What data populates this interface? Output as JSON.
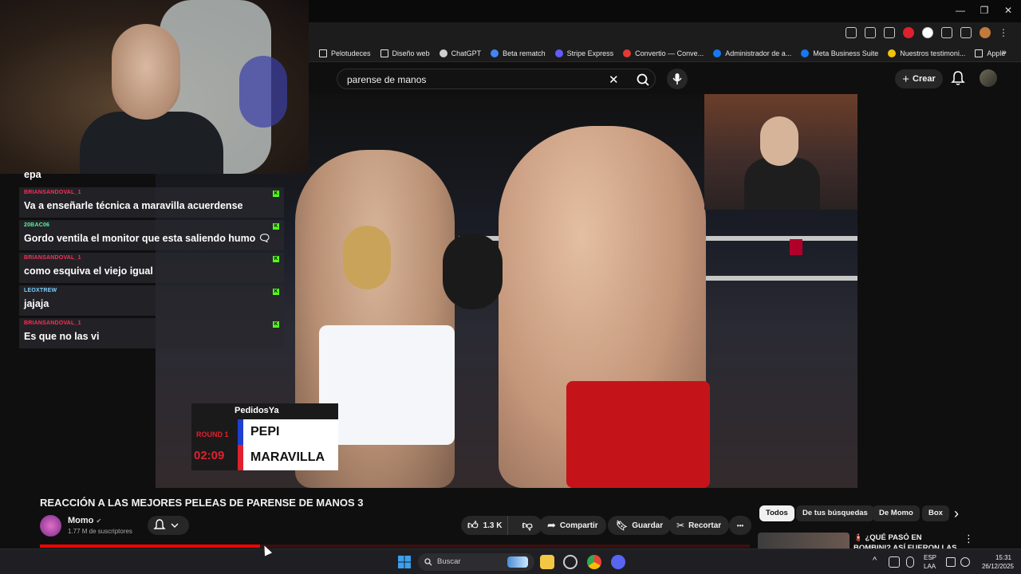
{
  "browser": {
    "window_controls": {
      "minimize": "—",
      "maximize": "❐",
      "close": "✕"
    },
    "bookmarks": [
      {
        "label": "Pelotudeces",
        "icon": "folder-icon",
        "color": "#e8e8e8"
      },
      {
        "label": "Diseño web",
        "icon": "folder-icon",
        "color": "#e8e8e8"
      },
      {
        "label": "ChatGPT",
        "icon": "chatgpt-icon",
        "color": "#cfcfcf"
      },
      {
        "label": "Beta rematch",
        "icon": "doc-icon",
        "color": "#4285f4"
      },
      {
        "label": "Stripe Express",
        "icon": "stripe-icon",
        "color": "#635bff"
      },
      {
        "label": "Convertio — Conve...",
        "icon": "convertio-icon",
        "color": "#e53935"
      },
      {
        "label": "Administrador de a...",
        "icon": "meta-icon",
        "color": "#1877f2"
      },
      {
        "label": "Meta Business Suite",
        "icon": "meta-icon",
        "color": "#1877f2"
      },
      {
        "label": "Nuestros testimoni...",
        "icon": "star-icon",
        "color": "#f4c20d"
      },
      {
        "label": "Apple",
        "icon": "folder-icon",
        "color": "#e8e8e8"
      }
    ],
    "more_bookmarks": "»"
  },
  "youtube": {
    "search": {
      "value": "parense de manos",
      "clear": "✕",
      "search_icon": "search-icon",
      "mic_icon": "mic-icon"
    },
    "create_label": "Crear",
    "create_icon": "+"
  },
  "overlay": {
    "chat": [
      {
        "user": "",
        "text": "epa",
        "user_color": "#ff2d55"
      },
      {
        "user": "BRIANSANDOVAL_1",
        "text": "Va a enseñarle técnica a maravilla acuerdense",
        "user_color": "#ff2d55"
      },
      {
        "user": "20BAC06",
        "text": "Gordo ventila el monitor que esta saliendo humo 🗨",
        "user_color": "#5cf0a0"
      },
      {
        "user": "BRIANSANDOVAL_1",
        "text": "como esquiva el viejo igual",
        "user_color": "#ff2d55"
      },
      {
        "user": "LEOXTREW",
        "text": "jajaja",
        "user_color": "#7fd0ff"
      },
      {
        "user": "BRIANSANDOVAL_1",
        "text": "Es que no las vi",
        "user_color": "#ff2d55"
      }
    ],
    "kick_badge": "K"
  },
  "scoreboard": {
    "brand": "PedidosYa",
    "round": "ROUND 1",
    "time": "02:09",
    "fighter_top": "PEPI",
    "fighter_bottom": "MARAVILLA",
    "top_color": "#1f3fd1",
    "bottom_color": "#e0202e"
  },
  "video": {
    "title": "REACCIÓN A LAS MEJORES PELEAS DE PARENSE DE MANOS 3",
    "channel": "Momo",
    "verified": "✔",
    "subscribers": "1.77 M de suscriptores",
    "likes": "1.3 K",
    "share": "Compartir",
    "save": "Guardar",
    "clip": "Recortar",
    "more": "•••",
    "progress": 0.31
  },
  "sidebar": {
    "chips": [
      "Todos",
      "De tus búsquedas",
      "De Momo",
      "Box"
    ],
    "next_arrow": "›",
    "recommended_title": "🧯 ¿QUÉ PASÓ EN BOMBINI? ASÍ FUERON LAS PELEAS |",
    "recommended_menu": "⋮"
  },
  "taskbar": {
    "search_placeholder": "Buscar",
    "tray_lang_top": "ESP",
    "tray_lang_bottom": "LAA",
    "time": "15:31",
    "date": "26/12/2025",
    "tray_up_arrow": "^"
  }
}
